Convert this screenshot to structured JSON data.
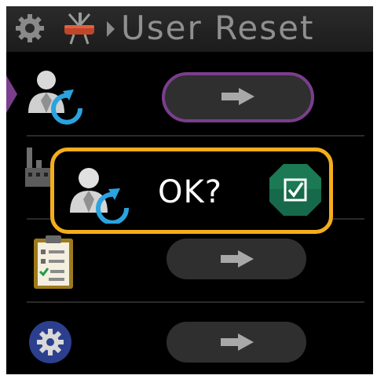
{
  "header": {
    "title": "User Reset",
    "settings_icon": "gear-icon",
    "tools_icon": "tools-icon"
  },
  "rows": [
    {
      "icon": "user-reset-icon",
      "action_icon": "arrow-right-icon",
      "selected": true
    },
    {
      "icon": "factory-icon",
      "action_icon": "arrow-right-icon",
      "selected": false
    },
    {
      "icon": "clipboard-checklist-icon",
      "action_icon": "arrow-right-icon",
      "selected": false
    },
    {
      "icon": "gear-circle-icon",
      "action_icon": "arrow-right-icon",
      "selected": false
    }
  ],
  "dialog": {
    "text": "OK?",
    "icon": "user-reset-icon",
    "confirm_icon": "checkbox-confirm-icon"
  },
  "colors": {
    "accent": "#7a3e8c",
    "dialog_border": "#f4ad1c",
    "button": "#2f2f2f",
    "confirm": "#16694a",
    "refresh": "#2aa3df"
  }
}
